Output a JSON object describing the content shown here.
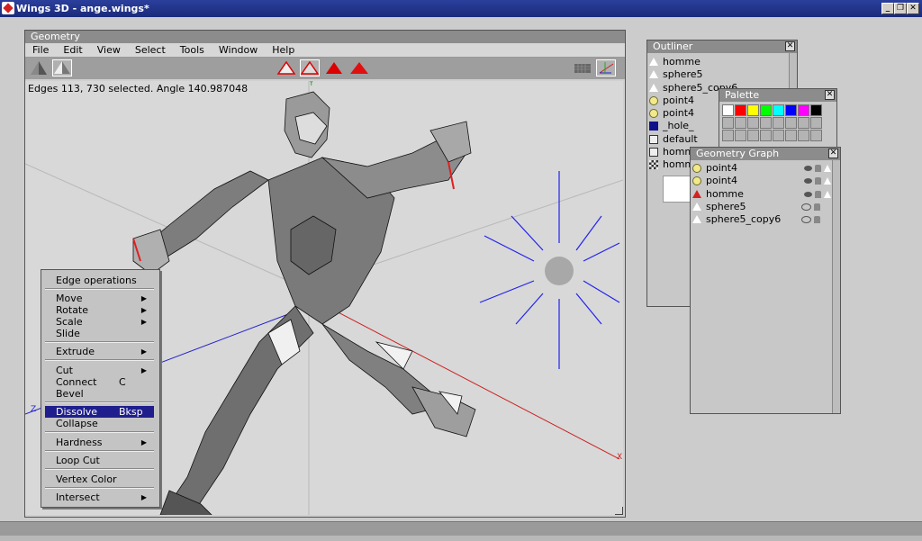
{
  "window": {
    "title": "Wings 3D - ange.wings*"
  },
  "geometry": {
    "title": "Geometry",
    "menu": [
      "File",
      "Edit",
      "View",
      "Select",
      "Tools",
      "Window",
      "Help"
    ],
    "info": "Edges 113, 730 selected. Angle 140.987048",
    "axis_labels": {
      "y": "Y",
      "x": "X",
      "z": "Z"
    }
  },
  "outliner": {
    "title": "Outliner",
    "items": [
      {
        "label": "homme",
        "icon": "white-triangle-icon"
      },
      {
        "label": "sphere5",
        "icon": "white-triangle-icon"
      },
      {
        "label": "sphere5_copy6",
        "icon": "white-triangle-icon"
      },
      {
        "label": "point4",
        "icon": "light-bulb-icon"
      },
      {
        "label": "point4",
        "icon": "light-bulb-icon"
      },
      {
        "label": "_hole_",
        "icon": "blue-material-icon"
      },
      {
        "label": "default",
        "icon": "material-icon"
      },
      {
        "label": "homme",
        "icon": "material-icon"
      },
      {
        "label": "homme",
        "icon": "checker-image-icon"
      }
    ]
  },
  "palette": {
    "title": "Palette",
    "colors": [
      "#ffffff",
      "#ff0000",
      "#ffff00",
      "#00ff00",
      "#00ffff",
      "#0000ff",
      "#ff00ff",
      "#000000"
    ]
  },
  "geometry_graph": {
    "title": "Geometry Graph",
    "items": [
      {
        "label": "point4",
        "icon": "light-bulb-icon"
      },
      {
        "label": "point4",
        "icon": "light-bulb-icon"
      },
      {
        "label": "homme",
        "icon": "red-triangle-icon"
      },
      {
        "label": "sphere5",
        "icon": "white-triangle-icon"
      },
      {
        "label": "sphere5_copy6",
        "icon": "white-triangle-icon"
      }
    ]
  },
  "context_menu": {
    "title": "Edge operations",
    "items": {
      "move": "Move",
      "rotate": "Rotate",
      "scale": "Scale",
      "slide": "Slide",
      "extrude": "Extrude",
      "cut": "Cut",
      "connect": "Connect",
      "connect_key": "C",
      "bevel": "Bevel",
      "dissolve": "Dissolve",
      "dissolve_key": "Bksp",
      "collapse": "Collapse",
      "hardness": "Hardness",
      "loop_cut": "Loop Cut",
      "vertex_color": "Vertex Color",
      "intersect": "Intersect"
    }
  },
  "colors": {
    "menu_highlight": "#1e1e8c",
    "titlebar": "#2b3f9c",
    "edge_selected": "#e02020",
    "axis_x": "#cc2222",
    "axis_z": "#2222cc",
    "light": "#2222ee"
  }
}
